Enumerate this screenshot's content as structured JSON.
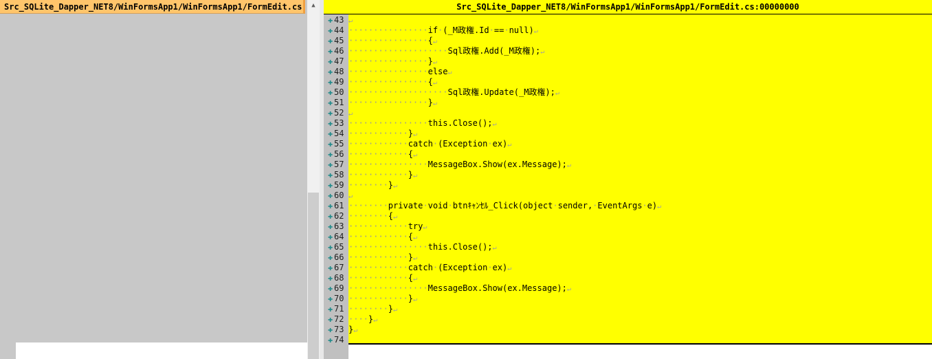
{
  "left_pane": {
    "header_title": "Src_SQLite_Dapper_NET8/WinFormsApp1/WinFormsApp1/FormEdit.cs"
  },
  "right_pane": {
    "header_title": "Src_SQLite_Dapper_NET8/WinFormsApp1/WinFormsApp1/FormEdit.cs:00000000"
  },
  "colors": {
    "left_header": "#ffc56b",
    "right_background": "#ffff00",
    "gutter": "#c0c0c0"
  },
  "icons": {
    "line_marker": "plus-icon",
    "line_end": "crlf-icon"
  },
  "lines": [
    {
      "num": "43",
      "indent": 0,
      "text": ""
    },
    {
      "num": "44",
      "indent": 16,
      "text": "if (_M政権.Id == null)"
    },
    {
      "num": "45",
      "indent": 16,
      "text": "{"
    },
    {
      "num": "46",
      "indent": 20,
      "text": "Sql政権.Add(_M政権);"
    },
    {
      "num": "47",
      "indent": 16,
      "text": "}"
    },
    {
      "num": "48",
      "indent": 16,
      "text": "else"
    },
    {
      "num": "49",
      "indent": 16,
      "text": "{"
    },
    {
      "num": "50",
      "indent": 20,
      "text": "Sql政権.Update(_M政権);"
    },
    {
      "num": "51",
      "indent": 16,
      "text": "}"
    },
    {
      "num": "52",
      "indent": 0,
      "text": ""
    },
    {
      "num": "53",
      "indent": 16,
      "text": "this.Close();"
    },
    {
      "num": "54",
      "indent": 12,
      "text": "}"
    },
    {
      "num": "55",
      "indent": 12,
      "text": "catch (Exception ex)"
    },
    {
      "num": "56",
      "indent": 12,
      "text": "{"
    },
    {
      "num": "57",
      "indent": 16,
      "text": "MessageBox.Show(ex.Message);"
    },
    {
      "num": "58",
      "indent": 12,
      "text": "}"
    },
    {
      "num": "59",
      "indent": 8,
      "text": "}"
    },
    {
      "num": "60",
      "indent": 0,
      "text": ""
    },
    {
      "num": "61",
      "indent": 8,
      "text": "private void btnｷｬﾝｾﾙ_Click(object sender, EventArgs e)"
    },
    {
      "num": "62",
      "indent": 8,
      "text": "{"
    },
    {
      "num": "63",
      "indent": 12,
      "text": "try"
    },
    {
      "num": "64",
      "indent": 12,
      "text": "{"
    },
    {
      "num": "65",
      "indent": 16,
      "text": "this.Close();"
    },
    {
      "num": "66",
      "indent": 12,
      "text": "}"
    },
    {
      "num": "67",
      "indent": 12,
      "text": "catch (Exception ex)"
    },
    {
      "num": "68",
      "indent": 12,
      "text": "{"
    },
    {
      "num": "69",
      "indent": 16,
      "text": "MessageBox.Show(ex.Message);"
    },
    {
      "num": "70",
      "indent": 12,
      "text": "}"
    },
    {
      "num": "71",
      "indent": 8,
      "text": "}"
    },
    {
      "num": "72",
      "indent": 4,
      "text": "}"
    },
    {
      "num": "73",
      "indent": 0,
      "text": "}"
    },
    {
      "num": "74",
      "indent": 0,
      "text": "",
      "no_eol": true
    }
  ]
}
